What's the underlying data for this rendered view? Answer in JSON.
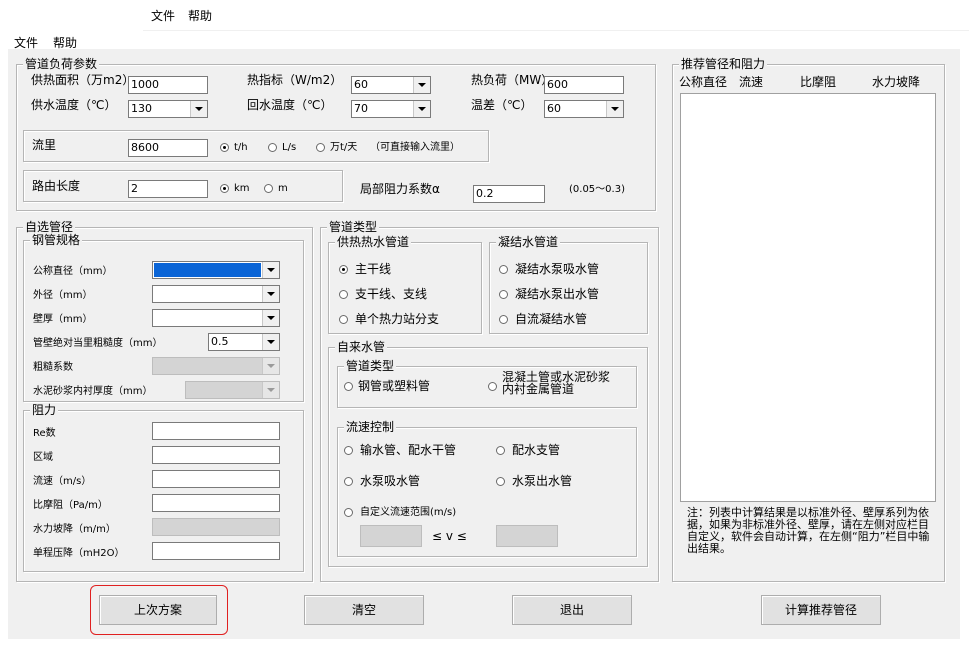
{
  "menus": {
    "file": "文件",
    "help": "帮助"
  },
  "load": {
    "title": "管道负荷参数",
    "area_label": "供热面积（万m2）",
    "area_value": "1000",
    "index_label": "热指标（W/m2）",
    "index_value": "60",
    "heatload_label": "热负荷（MW）",
    "heatload_value": "600",
    "supply_label": "供水温度（℃）",
    "supply_value": "130",
    "return_label": "回水温度（℃）",
    "return_value": "70",
    "diff_label": "温差（℃）",
    "diff_value": "60",
    "flow_label": "流里",
    "flow_value": "8600",
    "flow_units": [
      "t/h",
      "L/s",
      "万t/天"
    ],
    "flow_selected": "t/h",
    "flow_note": "（可直接输入流里）",
    "length_label": "路由长度",
    "length_value": "2",
    "length_units": [
      "km",
      "m"
    ],
    "length_selected": "km",
    "local_label": "局部阻力系数α",
    "local_value": "0.2",
    "local_range": "(0.05～0.3)"
  },
  "custom": {
    "title": "自选管径",
    "steel": {
      "title": "钢管规格",
      "dn_label": "公称直径（mm）",
      "od_label": "外径（mm）",
      "wall_label": "壁厚（mm）",
      "rough_label": "管壁绝对当里粗糙度（mm）",
      "rough_value": "0.5",
      "coef_label": "粗糙系数",
      "cement_label": "水泥砂浆内衬厚度（mm）"
    },
    "resist": {
      "title": "阻力",
      "re_label": "Re数",
      "zone_label": "区域",
      "vel_label": "流速（m/s）",
      "spec_label": "比摩阻（Pa/m）",
      "slope_label": "水力坡降（m/m）",
      "drop_label": "单程压降（mH2O）"
    }
  },
  "pipetype": {
    "title": "管道类型",
    "heat": {
      "title": "供热热水管道",
      "options": [
        "主干线",
        "支干线、支线",
        "单个热力站分支"
      ],
      "selected": "主干线"
    },
    "cond": {
      "title": "凝结水管道",
      "options": [
        "凝结水泵吸水管",
        "凝结水泵出水管",
        "自流凝结水管"
      ]
    },
    "water": {
      "title": "自来水管",
      "type_title": "管道类型",
      "type_options": [
        "钢管或塑料管",
        "混凝土管或水泥砂浆内衬金属管道"
      ],
      "vel_title": "流速控制",
      "vel_options": [
        "输水管、配水干管",
        "配水支管",
        "水泵吸水管",
        "水泵出水管",
        "自定义流速范围(m/s)"
      ],
      "range_mid": "≤ v ≤"
    }
  },
  "recommend": {
    "title": "推荐管径和阻力",
    "columns": [
      "公称直径",
      "流速",
      "比摩阻",
      "水力坡降"
    ],
    "note": "注：列表中计算结果是以标准外径、壁厚系列为依据，如果为非标准外径、壁厚，请在左侧对应栏目自定义，软件会自动计算，在左侧“阻力”栏目中输出结果。"
  },
  "buttons": {
    "last": "上次方案",
    "clear": "清空",
    "exit": "退出",
    "calc": "计算推荐管径"
  },
  "colors": {
    "highlight": "#e02020",
    "selection": "#0a64d6"
  }
}
